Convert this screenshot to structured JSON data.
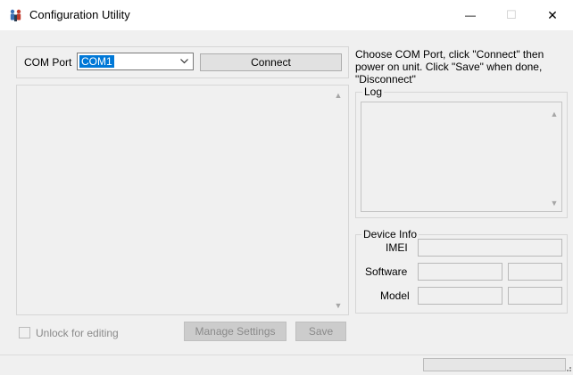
{
  "window": {
    "title": "Configuration Utility",
    "minimize_glyph": "—",
    "maximize_glyph": "☐",
    "close_glyph": "✕"
  },
  "com": {
    "label": "COM Port",
    "selected": "COM1",
    "connect_label": "Connect"
  },
  "instructions": "Choose COM Port, click \"Connect\" then power on unit.  Click \"Save\" when done, \"Disconnect\"",
  "log": {
    "title": "Log"
  },
  "device_info": {
    "title": "Device Info",
    "imei_label": "IMEI",
    "software_label": "Software",
    "model_label": "Model"
  },
  "bottom": {
    "unlock_label": "Unlock for editing",
    "manage_label": "Manage Settings",
    "save_label": "Save"
  },
  "icons": {
    "app": "people-app-icon",
    "dropdown": "chevron-down-icon",
    "scroll_up": "chevron-up-icon",
    "scroll_down": "chevron-down-icon",
    "size_grip": "size-grip-icon"
  },
  "colors": {
    "selection": "#0078d7",
    "window_bg": "#f0f0f0",
    "titlebar_bg": "#ffffff"
  }
}
